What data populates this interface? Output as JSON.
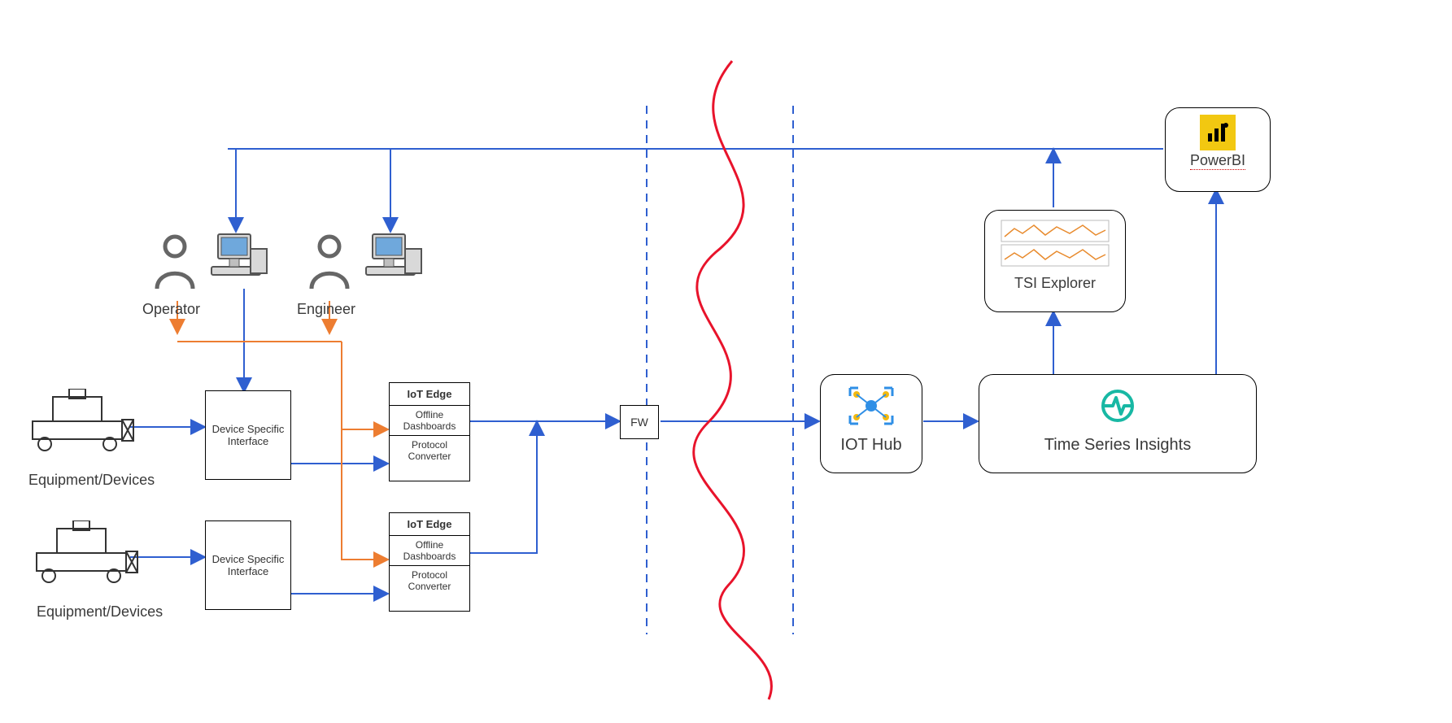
{
  "roles": {
    "operator": "Operator",
    "engineer": "Engineer"
  },
  "equipment": {
    "label1": "Equipment/Devices",
    "label2": "Equipment/Devices"
  },
  "dsi": {
    "label1": "Device Specific Interface",
    "label2": "Device Specific Interface"
  },
  "iot_edge": {
    "title": "IoT Edge",
    "offline": "Offline Dashboards",
    "protocol": "Protocol Converter"
  },
  "fw": {
    "label": "FW"
  },
  "iot_hub": {
    "label": "IOT Hub"
  },
  "tsi": {
    "label": "Time Series Insights"
  },
  "tsi_explorer": {
    "label": "TSI Explorer"
  },
  "powerbi": {
    "label": "PowerBI"
  },
  "colors": {
    "blue": "#2f5fd0",
    "orange": "#ed7d31",
    "red": "#e8132b",
    "dashblue": "#2f5fd0",
    "tsi_icon": "#18b8a4",
    "iothub_icon": "#2f8fe6"
  }
}
